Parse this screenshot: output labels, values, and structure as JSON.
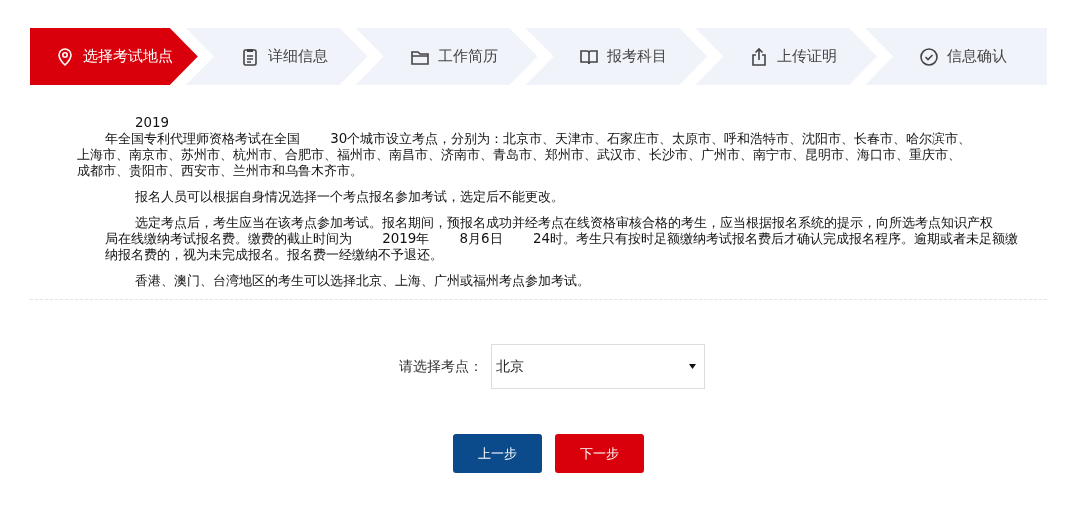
{
  "steps": [
    {
      "label": "选择考试地点",
      "selected": true
    },
    {
      "label": "详细信息",
      "selected": false
    },
    {
      "label": "工作简历",
      "selected": false
    },
    {
      "label": "报考科目",
      "selected": false
    },
    {
      "label": "上传证明",
      "selected": false
    },
    {
      "label": "信息确认",
      "selected": false
    }
  ],
  "notice": [
    {
      "kind": "hanging",
      "lines": [
        "2019",
        "年全国专利代理师资格考试在全国　　 30个城市设立考点，分别为：北京市、天津市、石家庄市、太原市、呼和浩特市、沈阳市、长春市、哈尔滨市、",
        "上海市、南京市、苏州市、杭州市、合肥市、福州市、南昌市、济南市、青岛市、郑州市、武汉市、长沙市、广州市、南宁市、昆明市、海口市、重庆市、",
        "成都市、贵阳市、西安市、兰州市和乌鲁木齐市。"
      ]
    },
    {
      "kind": "normal",
      "lines": [
        "报名人员可以根据自身情况选择一个考点报名参加考试，选定后不能更改。"
      ]
    },
    {
      "kind": "normal",
      "lines": [
        "选定考点后，考生应当在该考点参加考试。报名期间，预报名成功并经考点在线资格审核合格的考生，应当根据报名系统的提示，向所选考点知识产权",
        "局在线缴纳考试报名费。缴费的截止时间为　　 2019年　　 8月6日　　 24时。考生只有按时足额缴纳考试报名费后才确认完成报名程序。逾期或者未足额缴",
        "纳报名费的，视为未完成报名。报名费一经缴纳不予退还。"
      ]
    },
    {
      "kind": "normal",
      "lines": [
        "香港、澳门、台湾地区的考生可以选择北京、上海、广州或福州考点参加考试。"
      ]
    }
  ],
  "site_select": {
    "label": "请选择考点：",
    "value": "北京"
  },
  "buttons": [
    {
      "label": "上一步",
      "kind": "prev"
    },
    {
      "label": "下一步",
      "kind": "next"
    }
  ]
}
